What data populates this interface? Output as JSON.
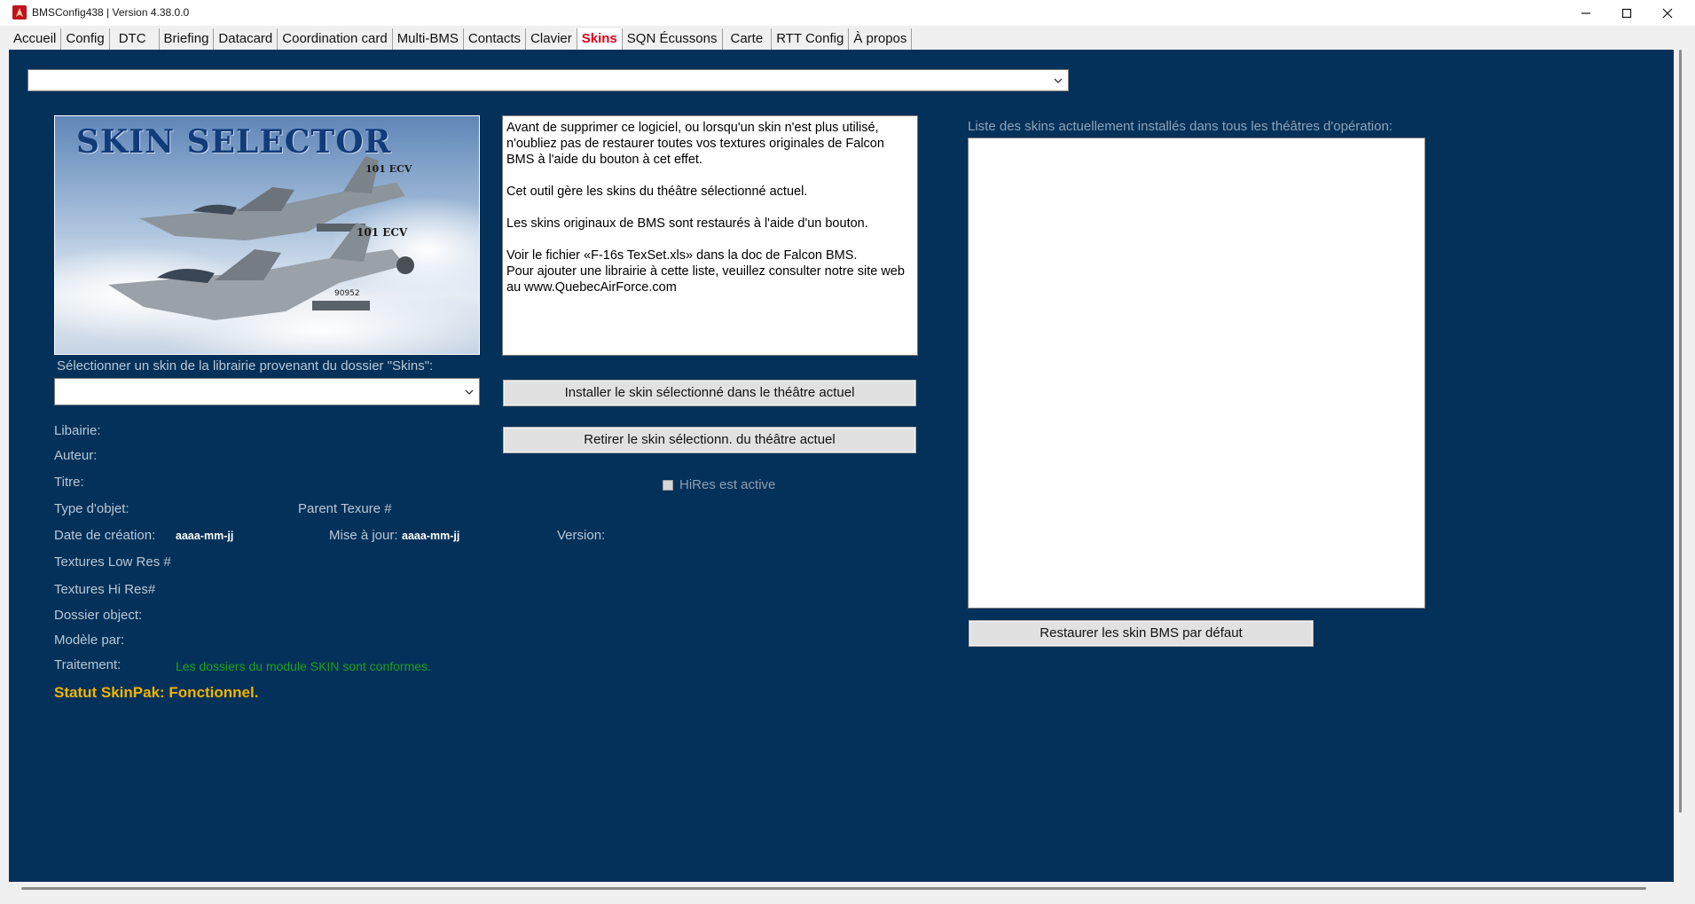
{
  "window": {
    "title": "BMSConfig438 | Version 4.38.0.0",
    "controls": {
      "minimize": "minimize-icon",
      "maximize": "maximize-icon",
      "close": "close-icon"
    }
  },
  "tabs": [
    {
      "label": "Accueil"
    },
    {
      "label": "Config"
    },
    {
      "label": "DTC"
    },
    {
      "label": "Briefing"
    },
    {
      "label": "Datacard"
    },
    {
      "label": "Coordination card"
    },
    {
      "label": "Multi-BMS"
    },
    {
      "label": "Contacts"
    },
    {
      "label": "Clavier"
    },
    {
      "label": "Skins",
      "active": true
    },
    {
      "label": "SQN Écussons"
    },
    {
      "label": "Carte"
    },
    {
      "label": "RTT Config"
    },
    {
      "label": "À propos"
    }
  ],
  "theatre_select": {
    "value": ""
  },
  "banner": {
    "title": "SKIN SELECTOR",
    "marking_top": "101 ECV",
    "marking_bottom": "101 ECV",
    "serial": "90952"
  },
  "info_text": {
    "p1": "Avant de supprimer ce logiciel, ou lorsqu'un skin n'est plus utilisé, n'oubliez pas de restaurer toutes vos textures originales de Falcon BMS à l'aide du bouton à cet effet.",
    "p2": "Cet outil gère les skins du théâtre sélectionné actuel.",
    "p3": "Les skins originaux de BMS sont restaurés à l'aide d'un bouton.",
    "p4": "Voir le fichier «F-16s TexSet.xls» dans la doc de Falcon BMS.\nPour ajouter une librairie à cette liste, veuillez consulter notre site web au www.QuebecAirForce.com"
  },
  "skin_select": {
    "label": "Sélectionner un skin de la librairie provenant du dossier \"Skins\":",
    "value": ""
  },
  "buttons": {
    "install": "Installer le skin sélectionné dans le théâtre actuel",
    "remove": "Retirer le skin sélectionn. du théâtre actuel",
    "restore": "Restaurer les skin BMS par défaut"
  },
  "hires_checkbox": {
    "label": "HiRes est active",
    "checked": false
  },
  "installed_list": {
    "label": "Liste des skins actuellement installés dans tous les théâtres d'opération:",
    "items": []
  },
  "details": {
    "librairie": "Libairie:",
    "auteur": "Auteur:",
    "titre": "Titre:",
    "type_objet": "Type d'objet:",
    "parent_texture": "Parent Texure #",
    "date_creation": "Date de création:",
    "date_creation_value": "aaaa-mm-jj",
    "mise_a_jour": "Mise à jour:",
    "mise_a_jour_value": "aaaa-mm-jj",
    "version": "Version:",
    "textures_low": "Textures Low Res #",
    "textures_hi": "Textures Hi Res#",
    "dossier_objet": "Dossier object:",
    "modele_par": "Modèle par:",
    "traitement": "Traitement:",
    "traitement_value": "Les dossiers du module SKIN sont conformes.",
    "statut": "Statut SkinPak: Fonctionnel."
  },
  "colors": {
    "panel_bg": "#043159",
    "active_tab": "#e0001a",
    "status_ok": "#1ea01e",
    "status_yellow": "#f1b400"
  }
}
